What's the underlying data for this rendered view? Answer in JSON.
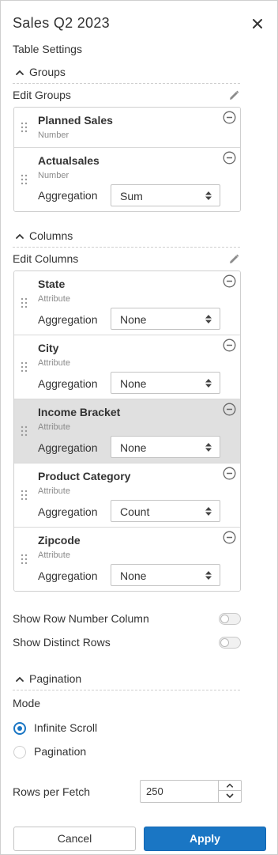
{
  "header": {
    "title": "Sales Q2 2023",
    "subtitle": "Table Settings"
  },
  "groups": {
    "section_label": "Groups",
    "edit_label": "Edit Groups",
    "items": [
      {
        "name": "Planned Sales",
        "type": "Number"
      },
      {
        "name": "Actualsales",
        "type": "Number",
        "aggregation_label": "Aggregation",
        "aggregation": "Sum"
      }
    ]
  },
  "columns": {
    "section_label": "Columns",
    "edit_label": "Edit Columns",
    "items": [
      {
        "name": "State",
        "type": "Attribute",
        "aggregation_label": "Aggregation",
        "aggregation": "None"
      },
      {
        "name": "City",
        "type": "Attribute",
        "aggregation_label": "Aggregation",
        "aggregation": "None"
      },
      {
        "name": "Income Bracket",
        "type": "Attribute",
        "aggregation_label": "Aggregation",
        "aggregation": "None",
        "highlighted": true
      },
      {
        "name": "Product Category",
        "type": "Attribute",
        "aggregation_label": "Aggregation",
        "aggregation": "Count"
      },
      {
        "name": "Zipcode",
        "type": "Attribute",
        "aggregation_label": "Aggregation",
        "aggregation": "None"
      }
    ]
  },
  "options": {
    "show_row_number": {
      "label": "Show Row Number Column",
      "on": false
    },
    "show_distinct": {
      "label": "Show Distinct Rows",
      "on": false
    }
  },
  "pagination": {
    "section_label": "Pagination",
    "mode_label": "Mode",
    "modes": [
      {
        "label": "Infinite Scroll",
        "selected": true
      },
      {
        "label": "Pagination",
        "selected": false
      }
    ],
    "rows_label": "Rows per Fetch",
    "rows_value": "250"
  },
  "footer": {
    "cancel_label": "Cancel",
    "apply_label": "Apply"
  },
  "colors": {
    "accent": "#1a76c4",
    "highlight_row": "#e0e0e0",
    "border": "#cfcfcf"
  },
  "icons": {
    "close": "close-icon",
    "chevron": "chevron-up-icon",
    "edit": "pencil-icon",
    "drag": "drag-handle-icon",
    "remove": "minus-circle-icon",
    "select": "sort-arrows-icon"
  }
}
